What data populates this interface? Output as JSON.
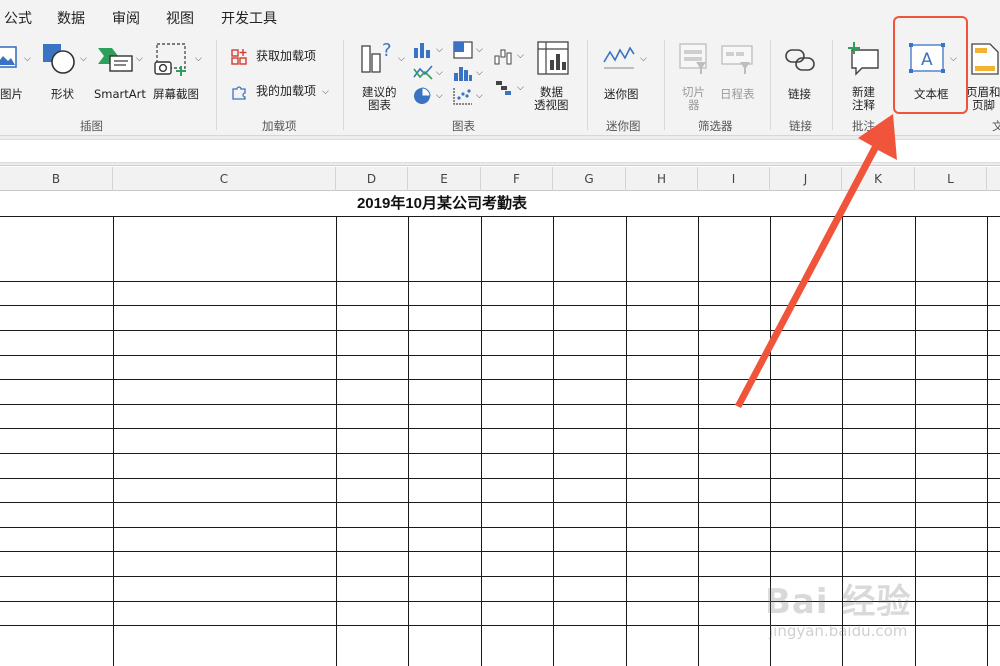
{
  "menu": {
    "tabs": [
      "公式",
      "数据",
      "审阅",
      "视图",
      "开发工具"
    ]
  },
  "ribbon": {
    "illustrations": {
      "picture_label": "图片",
      "shapes_label": "形状",
      "smartart_label": "SmartArt",
      "screenshot_label": "屏幕截图",
      "group_label": "插图"
    },
    "addins": {
      "get_addins_label": "获取加载项",
      "my_addins_label": "我的加载项",
      "group_label": "加载项"
    },
    "charts": {
      "recommended_label_1": "建议的",
      "recommended_label_2": "图表",
      "pivot_label_1": "数据",
      "pivot_label_2": "透视图",
      "group_label": "图表"
    },
    "sparklines": {
      "sparkline_label": "迷你图",
      "group_label": "迷你图"
    },
    "filters": {
      "slicer_label_1": "切片",
      "slicer_label_2": "器",
      "timeline_label": "日程表",
      "group_label": "筛选器"
    },
    "links": {
      "link_label": "链接",
      "group_label": "链接"
    },
    "comments": {
      "new_comment_label_1": "新建",
      "new_comment_label_2": "注释",
      "group_label": "批注"
    },
    "text": {
      "textbox_label": "文本框",
      "header_footer_label_1": "页眉和",
      "header_footer_label_2": "页脚",
      "group_label": "文"
    }
  },
  "columns": [
    "B",
    "C",
    "D",
    "E",
    "F",
    "G",
    "H",
    "I",
    "J",
    "K",
    "L"
  ],
  "sheet": {
    "title": "2019年10月某公司考勤表"
  },
  "watermark": {
    "main": "Bai 经验",
    "sub": "jingyan.baidu.com"
  },
  "colors": {
    "highlight": "#f0553c",
    "ribbon_bg": "#f3f3f3"
  }
}
